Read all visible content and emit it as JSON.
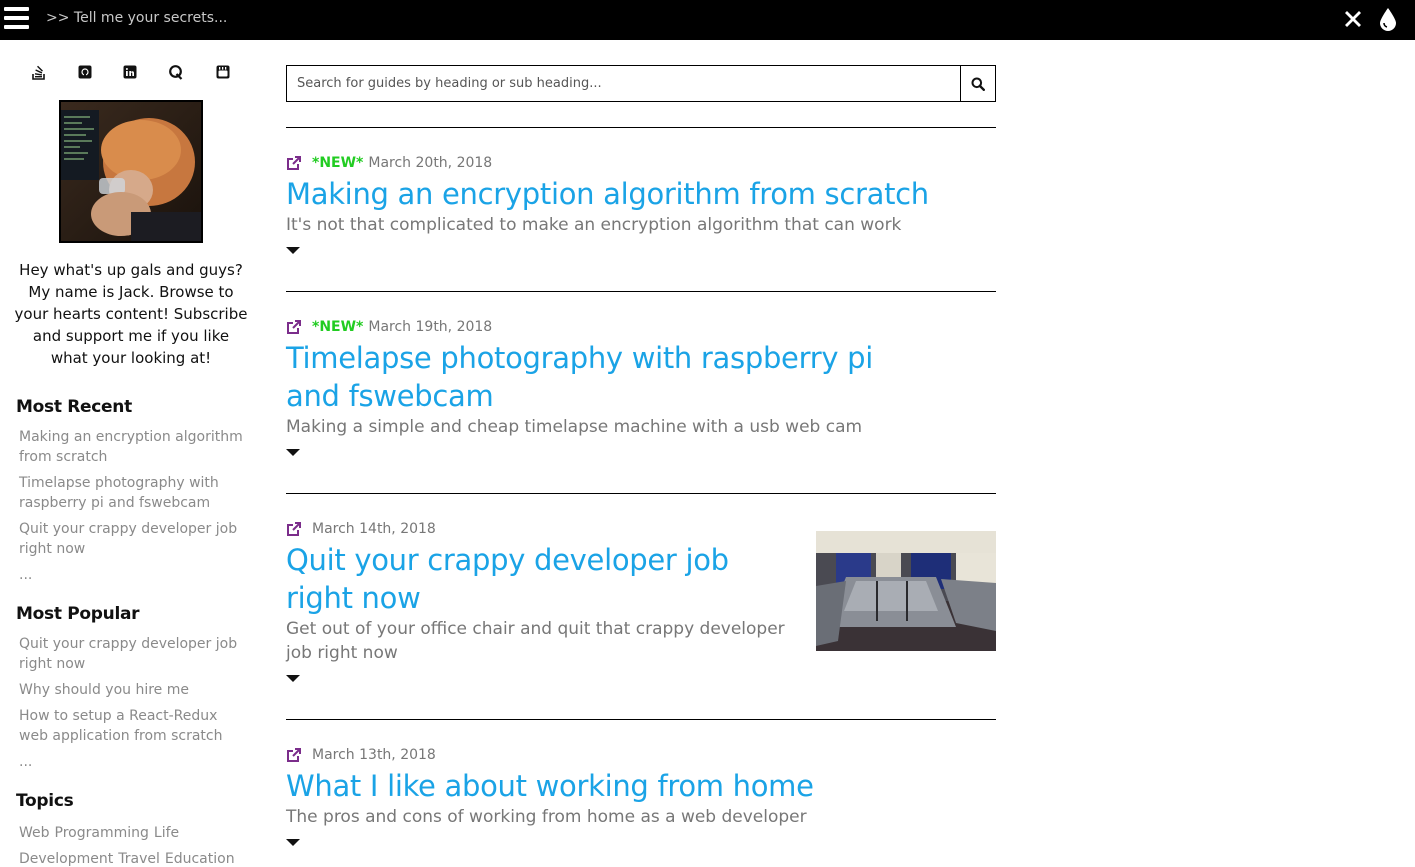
{
  "topbar": {
    "terminal_text": ">> Tell me your secrets..."
  },
  "sidebar": {
    "social": [
      "stackoverflow-icon",
      "github-icon",
      "linkedin-icon",
      "quora-icon",
      "youtube-icon"
    ],
    "bio": "Hey what's up gals and guys? My name is Jack. Browse to your hearts content! Subscribe and support me if you like what your looking at!",
    "most_recent": {
      "heading": "Most Recent",
      "items": [
        "Making an encryption algorithm from scratch",
        "Timelapse photography with raspberry pi and fswebcam",
        "Quit your crappy developer job right now"
      ],
      "more": "..."
    },
    "most_popular": {
      "heading": "Most Popular",
      "items": [
        "Quit your crappy developer job right now",
        "Why should you hire me",
        "How to setup a React-Redux web application from scratch"
      ],
      "more": "..."
    },
    "topics": {
      "heading": "Topics",
      "items": [
        "Web",
        "Programming",
        "Life",
        "Development",
        "Travel",
        "Education"
      ]
    }
  },
  "search": {
    "placeholder": "Search for guides by heading or sub heading..."
  },
  "articles": [
    {
      "badge": "*NEW*",
      "date": "March 20th, 2018",
      "title": "Making an encryption algorithm from scratch",
      "subtitle": "It's not that complicated to make an encryption algorithm that can work"
    },
    {
      "badge": "*NEW*",
      "date": "March 19th, 2018",
      "title": "Timelapse photography with raspberry pi and fswebcam",
      "subtitle": "Making a simple and cheap timelapse machine with a usb web cam"
    },
    {
      "badge": "",
      "date": "March 14th, 2018",
      "title": "Quit your crappy developer job right now",
      "subtitle": "Get out of your office chair and quit that crappy developer job right now"
    },
    {
      "badge": "",
      "date": "March 13th, 2018",
      "title": "What I like about working from home",
      "subtitle": "The pros and cons of working from home as a web developer"
    }
  ],
  "colors": {
    "accent": "#1aa3e6",
    "new_badge": "#22cc22",
    "muted": "#777777",
    "topbar": "#000000"
  }
}
